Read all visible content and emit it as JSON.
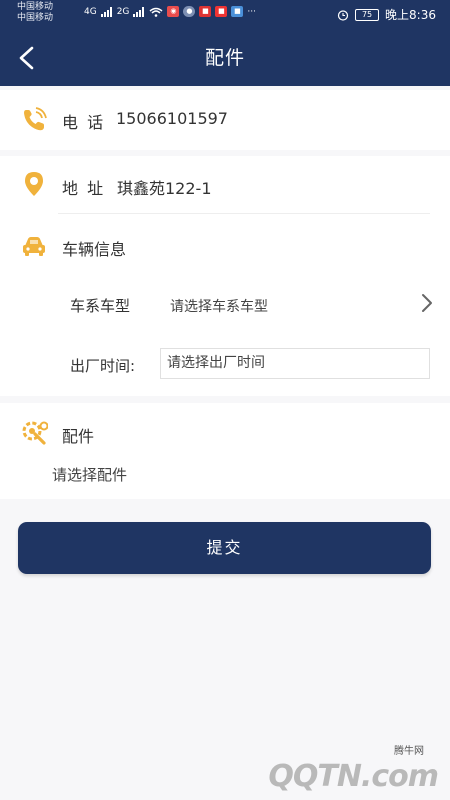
{
  "status_bar": {
    "carrier_1": "中国移动",
    "carrier_2": "中国移动",
    "network_1": "4G",
    "network_2": "2G",
    "battery": "75",
    "time": "晚上8:36"
  },
  "header": {
    "title": "配件",
    "back_icon": "chevron-left-icon"
  },
  "contact": {
    "phone_label": "电 话",
    "phone_value": "15066101597",
    "address_label": "地 址",
    "address_value": "琪鑫苑122-1"
  },
  "vehicle": {
    "section_label": "车辆信息",
    "model_label": "车系车型",
    "model_placeholder": "请选择车系车型",
    "date_label": "出厂时间:",
    "date_placeholder": "请选择出厂时间"
  },
  "parts": {
    "section_label": "配件",
    "placeholder": "请选择配件"
  },
  "submit_label": "提交",
  "watermark": {
    "text": "腾牛网",
    "logo": "QQTN.com"
  },
  "colors": {
    "primary": "#1f3563",
    "icon_accent": "#f0b23c",
    "background": "#f7f7f9"
  }
}
